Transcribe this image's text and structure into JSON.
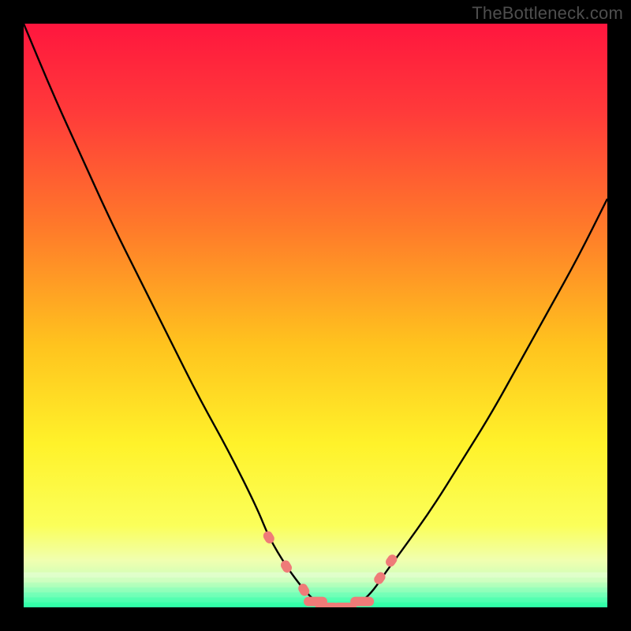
{
  "attribution": "TheBottleneck.com",
  "chart_data": {
    "type": "line",
    "title": "",
    "xlabel": "",
    "ylabel": "",
    "xlim": [
      0,
      100
    ],
    "ylim": [
      0,
      100
    ],
    "grid": false,
    "legend": false,
    "series": [
      {
        "name": "curve",
        "x": [
          0,
          5,
          10,
          15,
          20,
          25,
          30,
          35,
          40,
          42,
          45,
          48,
          50,
          52,
          55,
          58,
          60,
          62,
          65,
          70,
          75,
          80,
          85,
          90,
          95,
          100
        ],
        "y": [
          100,
          88,
          77,
          66,
          56,
          46,
          36,
          27,
          17,
          12,
          7,
          3,
          1,
          0,
          0,
          1,
          3,
          6,
          10,
          17,
          25,
          33,
          42,
          51,
          60,
          70
        ]
      }
    ],
    "markers": {
      "name": "bottom-markers",
      "x": [
        42,
        45,
        48,
        50,
        52,
        55,
        58,
        61,
        63
      ],
      "y": [
        12,
        7,
        3,
        1,
        0,
        0,
        1,
        5,
        8
      ]
    },
    "green_band_y": [
      0,
      6
    ],
    "gradient_stops": [
      {
        "pos": 0.0,
        "color": "#ff163e"
      },
      {
        "pos": 0.15,
        "color": "#ff3a3a"
      },
      {
        "pos": 0.35,
        "color": "#ff7a2a"
      },
      {
        "pos": 0.55,
        "color": "#ffc31e"
      },
      {
        "pos": 0.72,
        "color": "#fff22a"
      },
      {
        "pos": 0.86,
        "color": "#fbff5a"
      },
      {
        "pos": 0.92,
        "color": "#f0ffb0"
      },
      {
        "pos": 0.955,
        "color": "#c8ffb8"
      },
      {
        "pos": 0.975,
        "color": "#7dffb5"
      },
      {
        "pos": 1.0,
        "color": "#2dffa7"
      }
    ]
  }
}
